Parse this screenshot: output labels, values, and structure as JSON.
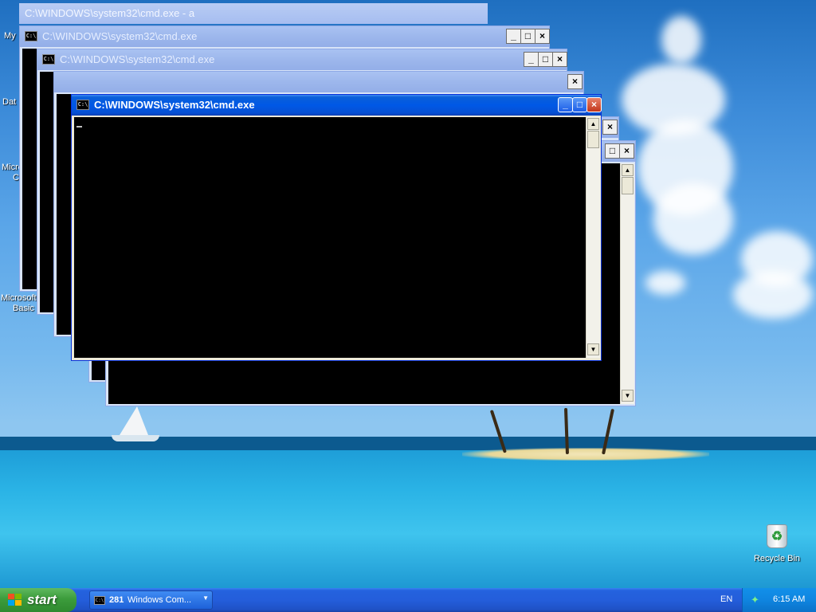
{
  "windows": {
    "title_back": "C:\\WINDOWS\\system32\\cmd.exe - a",
    "title": "C:\\WINDOWS\\system32\\cmd.exe",
    "icon_text": "C:\\",
    "min_glyph": "_",
    "max_glyph": "□",
    "close_glyph": "×"
  },
  "scrollbar": {
    "up": "▲",
    "down": "▼"
  },
  "desktop_icons": {
    "my_partial": "My",
    "dat_partial": "Dat",
    "ms_partial": "Micros",
    "ms_partial_2": "C",
    "ms_basic_1": "Microsoft",
    "ms_basic_2": "Basic",
    "recycle_bin": "Recycle Bin"
  },
  "taskbar": {
    "start": "start",
    "task_count": "281",
    "task_label": "Windows Com...",
    "language": "EN",
    "clock": "6:15 AM",
    "colors": {
      "start_green": "#3c9c3c",
      "taskbar_blue": "#245edb",
      "tray_blue": "#0f85e0"
    }
  }
}
